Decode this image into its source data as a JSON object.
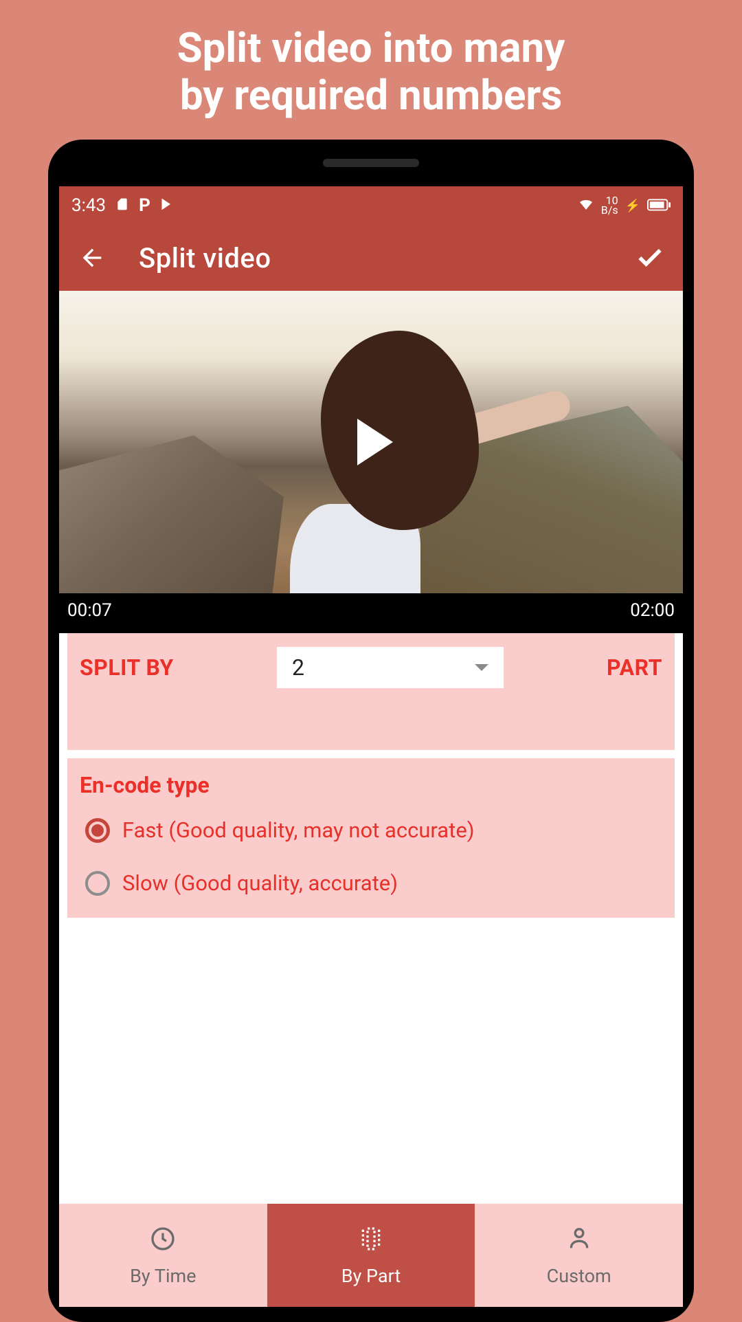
{
  "promo": {
    "line1": "Split video into many",
    "line2": "by required numbers"
  },
  "statusbar": {
    "time": "3:43",
    "speed": "10\nB/s"
  },
  "appbar": {
    "title": "Split video"
  },
  "video": {
    "time_current": "00:07",
    "time_total": "02:00"
  },
  "split": {
    "label": "SPLIT BY",
    "value": "2",
    "unit": "PART"
  },
  "encode": {
    "title": "En-code type",
    "options": [
      {
        "label": "Fast (Good quality, may not accurate)",
        "selected": true
      },
      {
        "label": "Slow (Good quality, accurate)",
        "selected": false
      }
    ]
  },
  "nav": {
    "by_time": "By Time",
    "by_part": "By Part",
    "custom": "Custom"
  }
}
